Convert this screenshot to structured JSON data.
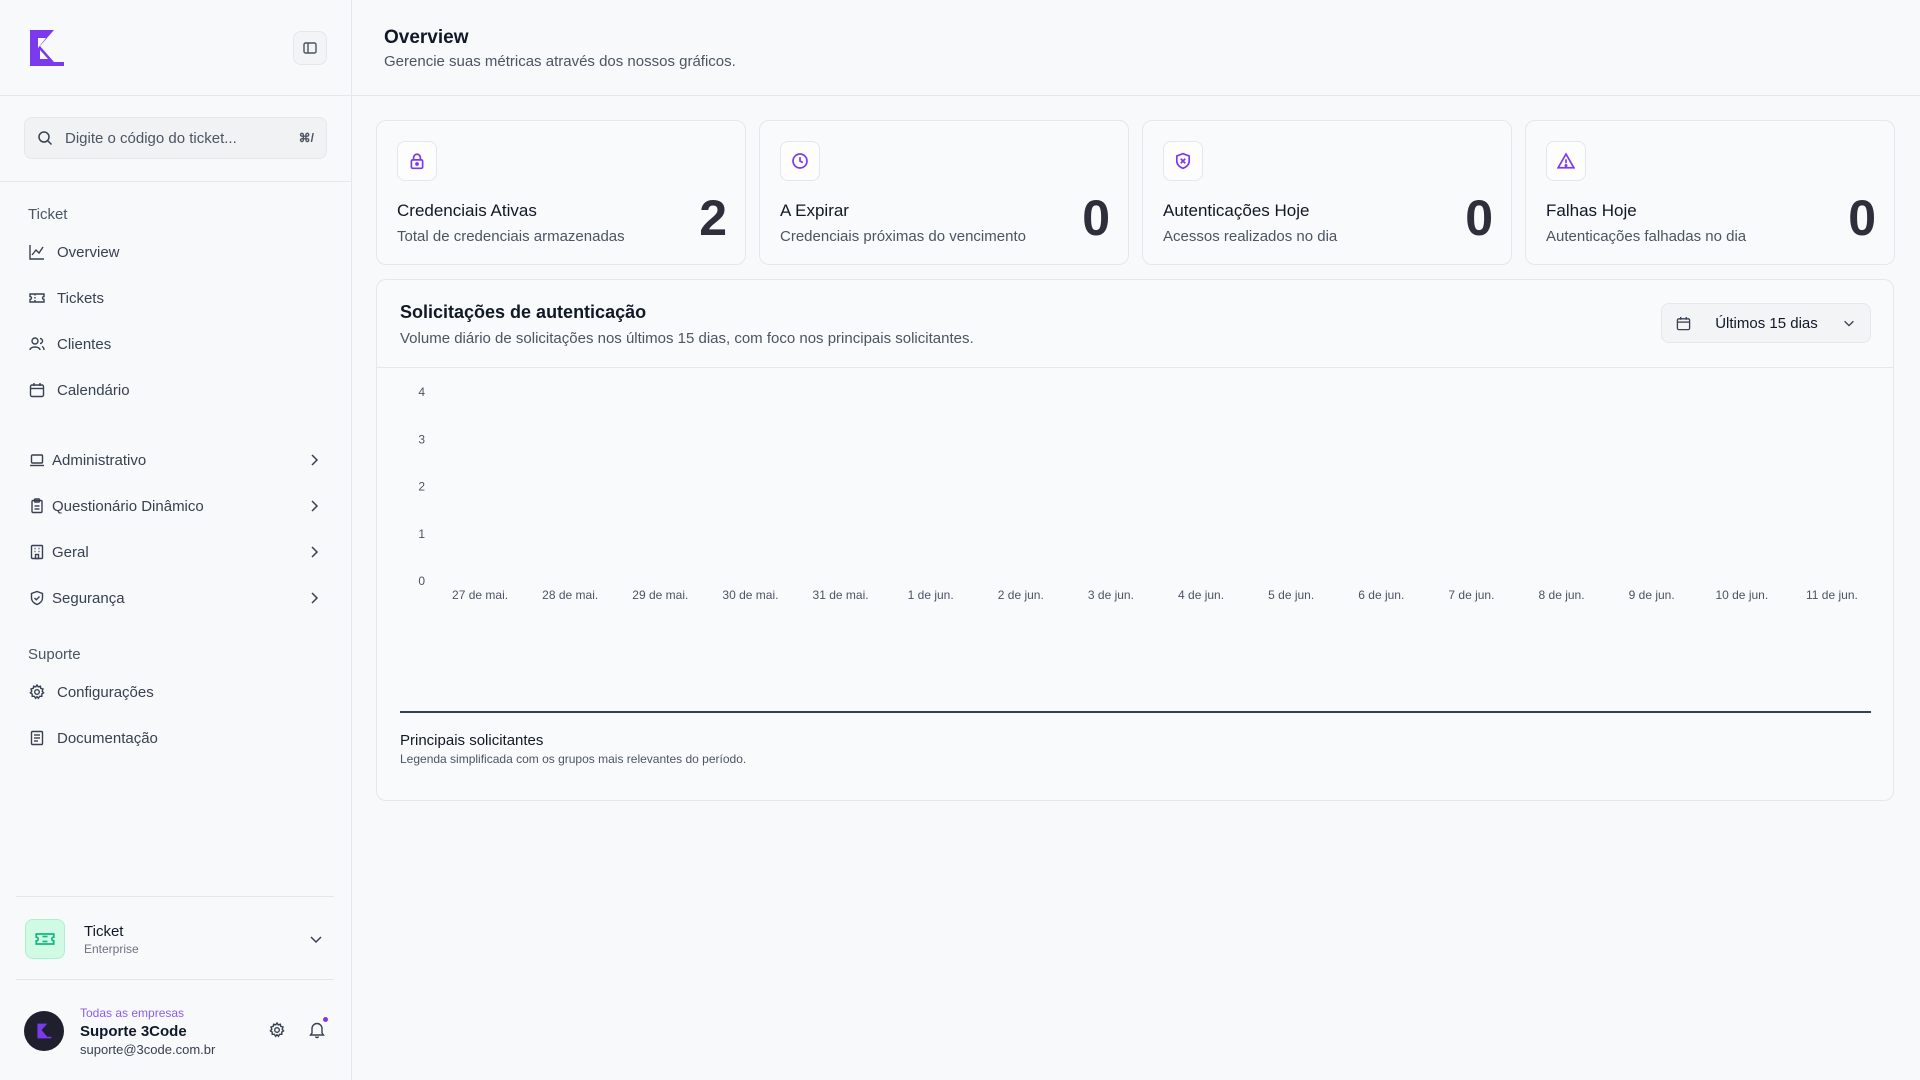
{
  "sidebar": {
    "search_placeholder": "Digite o código do ticket...",
    "search_shortcut": "⌘/",
    "groups": {
      "ticket_label": "Ticket",
      "suporte_label": "Suporte"
    },
    "ticket_items": [
      {
        "label": "Overview",
        "icon": "line-chart-icon"
      },
      {
        "label": "Tickets",
        "icon": "ticket-icon"
      },
      {
        "label": "Clientes",
        "icon": "users-icon"
      },
      {
        "label": "Calendário",
        "icon": "calendar-icon"
      }
    ],
    "admin_items": [
      {
        "label": "Administrativo",
        "icon": "laptop-icon"
      },
      {
        "label": "Questionário Dinâmico",
        "icon": "clipboard-icon"
      },
      {
        "label": "Geral",
        "icon": "building-icon"
      },
      {
        "label": "Segurança",
        "icon": "shield-icon"
      }
    ],
    "suporte_items": [
      {
        "label": "Configurações",
        "icon": "gear-icon"
      },
      {
        "label": "Documentação",
        "icon": "document-icon"
      }
    ],
    "org": {
      "name": "Ticket",
      "plan": "Enterprise"
    },
    "user": {
      "scope": "Todas as empresas",
      "name": "Suporte 3Code",
      "email": "suporte@3code.com.br"
    }
  },
  "header": {
    "title": "Overview",
    "subtitle": "Gerencie suas métricas através dos nossos gráficos."
  },
  "kpis": [
    {
      "title": "Credenciais Ativas",
      "desc": "Total de credenciais armazenadas",
      "value": "2",
      "icon": "lock-icon"
    },
    {
      "title": "A Expirar",
      "desc": "Credenciais próximas do vencimento",
      "value": "0",
      "icon": "clock-icon"
    },
    {
      "title": "Autenticações Hoje",
      "desc": "Acessos realizados no dia",
      "value": "0",
      "icon": "shield-x-icon"
    },
    {
      "title": "Falhas Hoje",
      "desc": "Autenticações falhadas no dia",
      "value": "0",
      "icon": "warning-icon"
    }
  ],
  "chart_card": {
    "title": "Solicitações de autenticação",
    "subtitle": "Volume diário de solicitações nos últimos 15 dias, com foco nos principais solicitantes.",
    "range_label": "Últimos 15 dias",
    "legend_title": "Principais solicitantes",
    "legend_subtitle": "Legenda simplificada com os grupos mais relevantes do período."
  },
  "chart_data": {
    "type": "bar",
    "categories": [
      "27 de mai.",
      "28 de mai.",
      "29 de mai.",
      "30 de mai.",
      "31 de mai.",
      "1 de jun.",
      "2 de jun.",
      "3 de jun.",
      "4 de jun.",
      "5 de jun.",
      "6 de jun.",
      "7 de jun.",
      "8 de jun.",
      "9 de jun.",
      "10 de jun.",
      "11 de jun."
    ],
    "values": [
      0,
      0,
      0,
      0,
      0,
      0,
      0,
      0,
      0,
      0,
      0,
      0,
      0,
      0,
      0,
      0
    ],
    "y_ticks": [
      0,
      1,
      2,
      3,
      4
    ],
    "ylim": [
      0,
      4
    ],
    "title": "",
    "xlabel": "",
    "ylabel": "",
    "grid": false
  },
  "colors": {
    "accent": "#7c3aed",
    "org_accent": "#10b981"
  }
}
